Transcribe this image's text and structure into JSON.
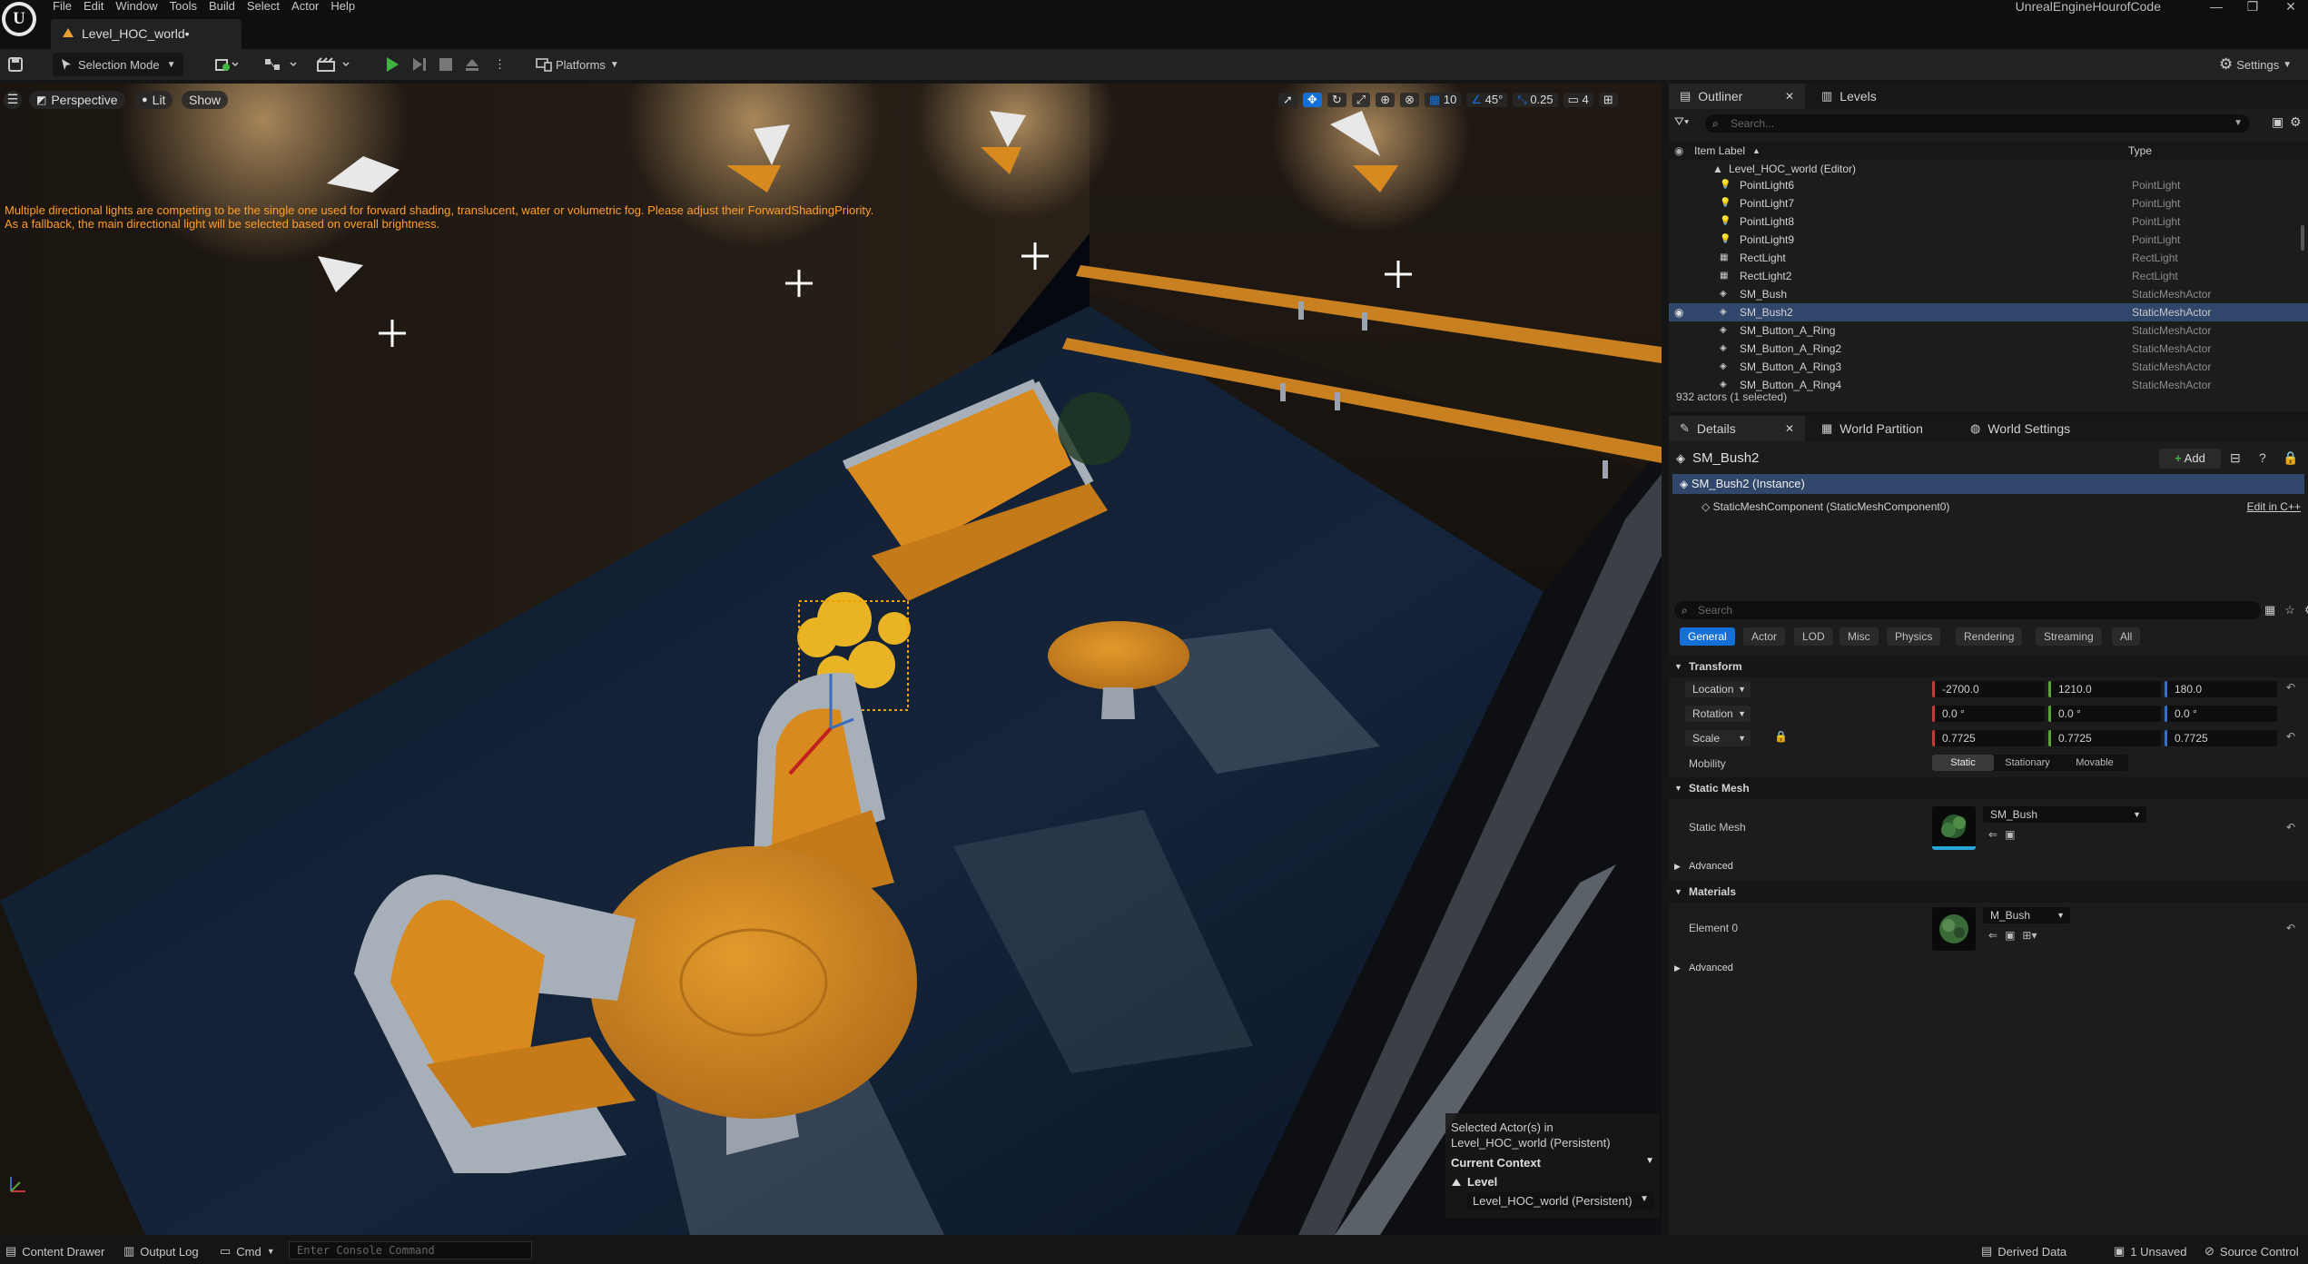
{
  "app": {
    "window_title": "UnrealEngineHourofCode",
    "level_tab": "Level_HOC_world•"
  },
  "menu": [
    "File",
    "Edit",
    "Window",
    "Tools",
    "Build",
    "Select",
    "Actor",
    "Help"
  ],
  "toolbar": {
    "selection_mode": "Selection Mode",
    "platforms": "Platforms",
    "settings": "Settings"
  },
  "viewport": {
    "perspective": "Perspective",
    "lit": "Lit",
    "show": "Show",
    "grid_snap": "10",
    "rotation_snap": "45°",
    "scale_snap": "0.25",
    "camera_speed": "4",
    "warning_line1": "Multiple directional lights are competing to be the single one used for forward shading, translucent, water or volumetric fog. Please adjust their ForwardShadingPriority.",
    "warning_line2": "As a fallback, the main directional light will be selected based on overall brightness.",
    "context": {
      "selected_line1": "Selected Actor(s) in",
      "selected_line2": "Level_HOC_world (Persistent)",
      "current_context": "Current Context",
      "level_label": "Level",
      "level_value": "Level_HOC_world (Persistent)"
    }
  },
  "outliner": {
    "tab_outliner": "Outliner",
    "tab_levels": "Levels",
    "search_placeholder": "Search...",
    "col_label": "Item Label",
    "col_type": "Type",
    "root": "Level_HOC_world (Editor)",
    "rows": [
      {
        "label": "PointLight6",
        "type": "PointLight",
        "icon": "bulb"
      },
      {
        "label": "PointLight7",
        "type": "PointLight",
        "icon": "bulb"
      },
      {
        "label": "PointLight8",
        "type": "PointLight",
        "icon": "bulb"
      },
      {
        "label": "PointLight9",
        "type": "PointLight",
        "icon": "bulb"
      },
      {
        "label": "RectLight",
        "type": "RectLight",
        "icon": "grid"
      },
      {
        "label": "RectLight2",
        "type": "RectLight",
        "icon": "grid"
      },
      {
        "label": "SM_Bush",
        "type": "StaticMeshActor",
        "icon": "mesh"
      },
      {
        "label": "SM_Bush2",
        "type": "StaticMeshActor",
        "icon": "mesh",
        "selected": true
      },
      {
        "label": "SM_Button_A_Ring",
        "type": "StaticMeshActor",
        "icon": "mesh"
      },
      {
        "label": "SM_Button_A_Ring2",
        "type": "StaticMeshActor",
        "icon": "mesh"
      },
      {
        "label": "SM_Button_A_Ring3",
        "type": "StaticMeshActor",
        "icon": "mesh"
      },
      {
        "label": "SM_Button_A_Ring4",
        "type": "StaticMeshActor",
        "icon": "mesh"
      }
    ],
    "footer": "932 actors (1 selected)"
  },
  "details": {
    "tab_details": "Details",
    "tab_world_partition": "World Partition",
    "tab_world_settings": "World Settings",
    "actor_name": "SM_Bush2",
    "add_label": "Add",
    "instance": "SM_Bush2 (Instance)",
    "component": "StaticMeshComponent (StaticMeshComponent0)",
    "edit_in_cpp": "Edit in C++",
    "search_placeholder": "Search",
    "filters": [
      "General",
      "Actor",
      "LOD",
      "Misc",
      "Physics",
      "Rendering",
      "Streaming",
      "All"
    ],
    "transform": {
      "section": "Transform",
      "location_label": "Location",
      "location": [
        "-2700.0",
        "1210.0",
        "180.0"
      ],
      "rotation_label": "Rotation",
      "rotation": [
        "0.0 °",
        "0.0 °",
        "0.0 °"
      ],
      "scale_label": "Scale",
      "scale": [
        "0.7725",
        "0.7725",
        "0.7725"
      ],
      "mobility_label": "Mobility",
      "mobility": [
        "Static",
        "Stationary",
        "Movable"
      ]
    },
    "static_mesh": {
      "section": "Static Mesh",
      "label": "Static Mesh",
      "value": "SM_Bush"
    },
    "advanced": "Advanced",
    "materials": {
      "section": "Materials",
      "element_label": "Element 0",
      "value": "M_Bush"
    }
  },
  "status": {
    "content_drawer": "Content Drawer",
    "output_log": "Output Log",
    "cmd": "Cmd",
    "console_placeholder": "Enter Console Command",
    "derived_data": "Derived Data",
    "unsaved": "1 Unsaved",
    "source_control": "Source Control"
  },
  "colors": {
    "accent": "#1470d6",
    "selection": "#31466b",
    "warning": "#ff9e2a",
    "furniture": "#d88a1e"
  }
}
